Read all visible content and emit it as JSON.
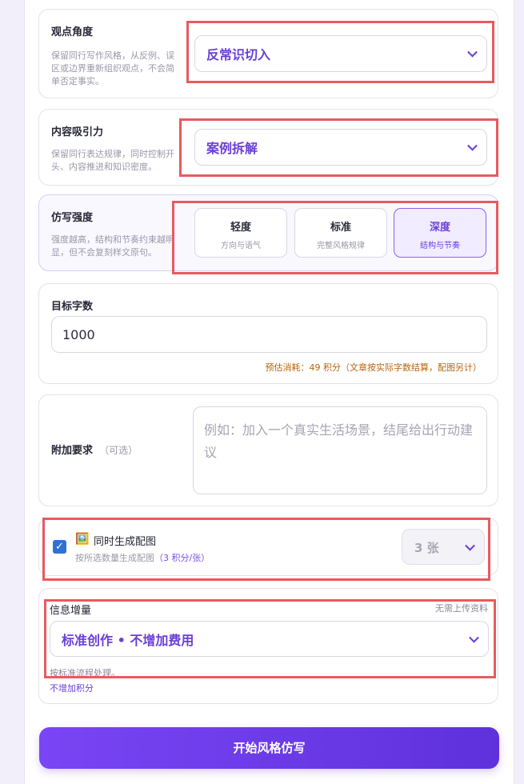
{
  "viewpoint": {
    "title": "观点角度",
    "desc": "保留同行写作风格，从反例、误区或边界重新组织观点，不会简单否定事实。",
    "selected": "反常识切入"
  },
  "attraction": {
    "title": "内容吸引力",
    "desc": "保留同行表达规律，同时控制开头、内容推进和知识密度。",
    "selected": "案例拆解"
  },
  "intensity": {
    "title": "仿写强度",
    "desc": "强度越高，结构和节奏约束越明显，但不会复刻样文原句。",
    "options": [
      {
        "title": "轻度",
        "sub": "方向与语气"
      },
      {
        "title": "标准",
        "sub": "完整风格规律"
      },
      {
        "title": "深度",
        "sub": "结构与节奏"
      }
    ],
    "active_index": 2
  },
  "word_count": {
    "title": "目标字数",
    "value": "1000",
    "estimate": "预估消耗：49 积分（文章按实际字数结算，配图另计）"
  },
  "extra": {
    "title": "附加要求",
    "optional": "（可选）",
    "placeholder": "例如：加入一个真实生活场景，结尾给出行动建议"
  },
  "image_gen": {
    "icon": "🖼️",
    "label": "同时生成配图",
    "hint_prefix": "按所选数量生成配图",
    "hint_cost": "（3 积分/张）",
    "checked": true,
    "count": "3 张"
  },
  "info": {
    "title": "信息增量",
    "note": "无需上传资料",
    "selected": "标准创作 • 不增加费用",
    "desc": "按标准流程处理。",
    "cost": "不增加积分"
  },
  "submit_label": "开始风格仿写",
  "colors": {
    "accent": "#6a3fd8",
    "highlight": "#e85a5f",
    "estimate": "#b8650c"
  }
}
